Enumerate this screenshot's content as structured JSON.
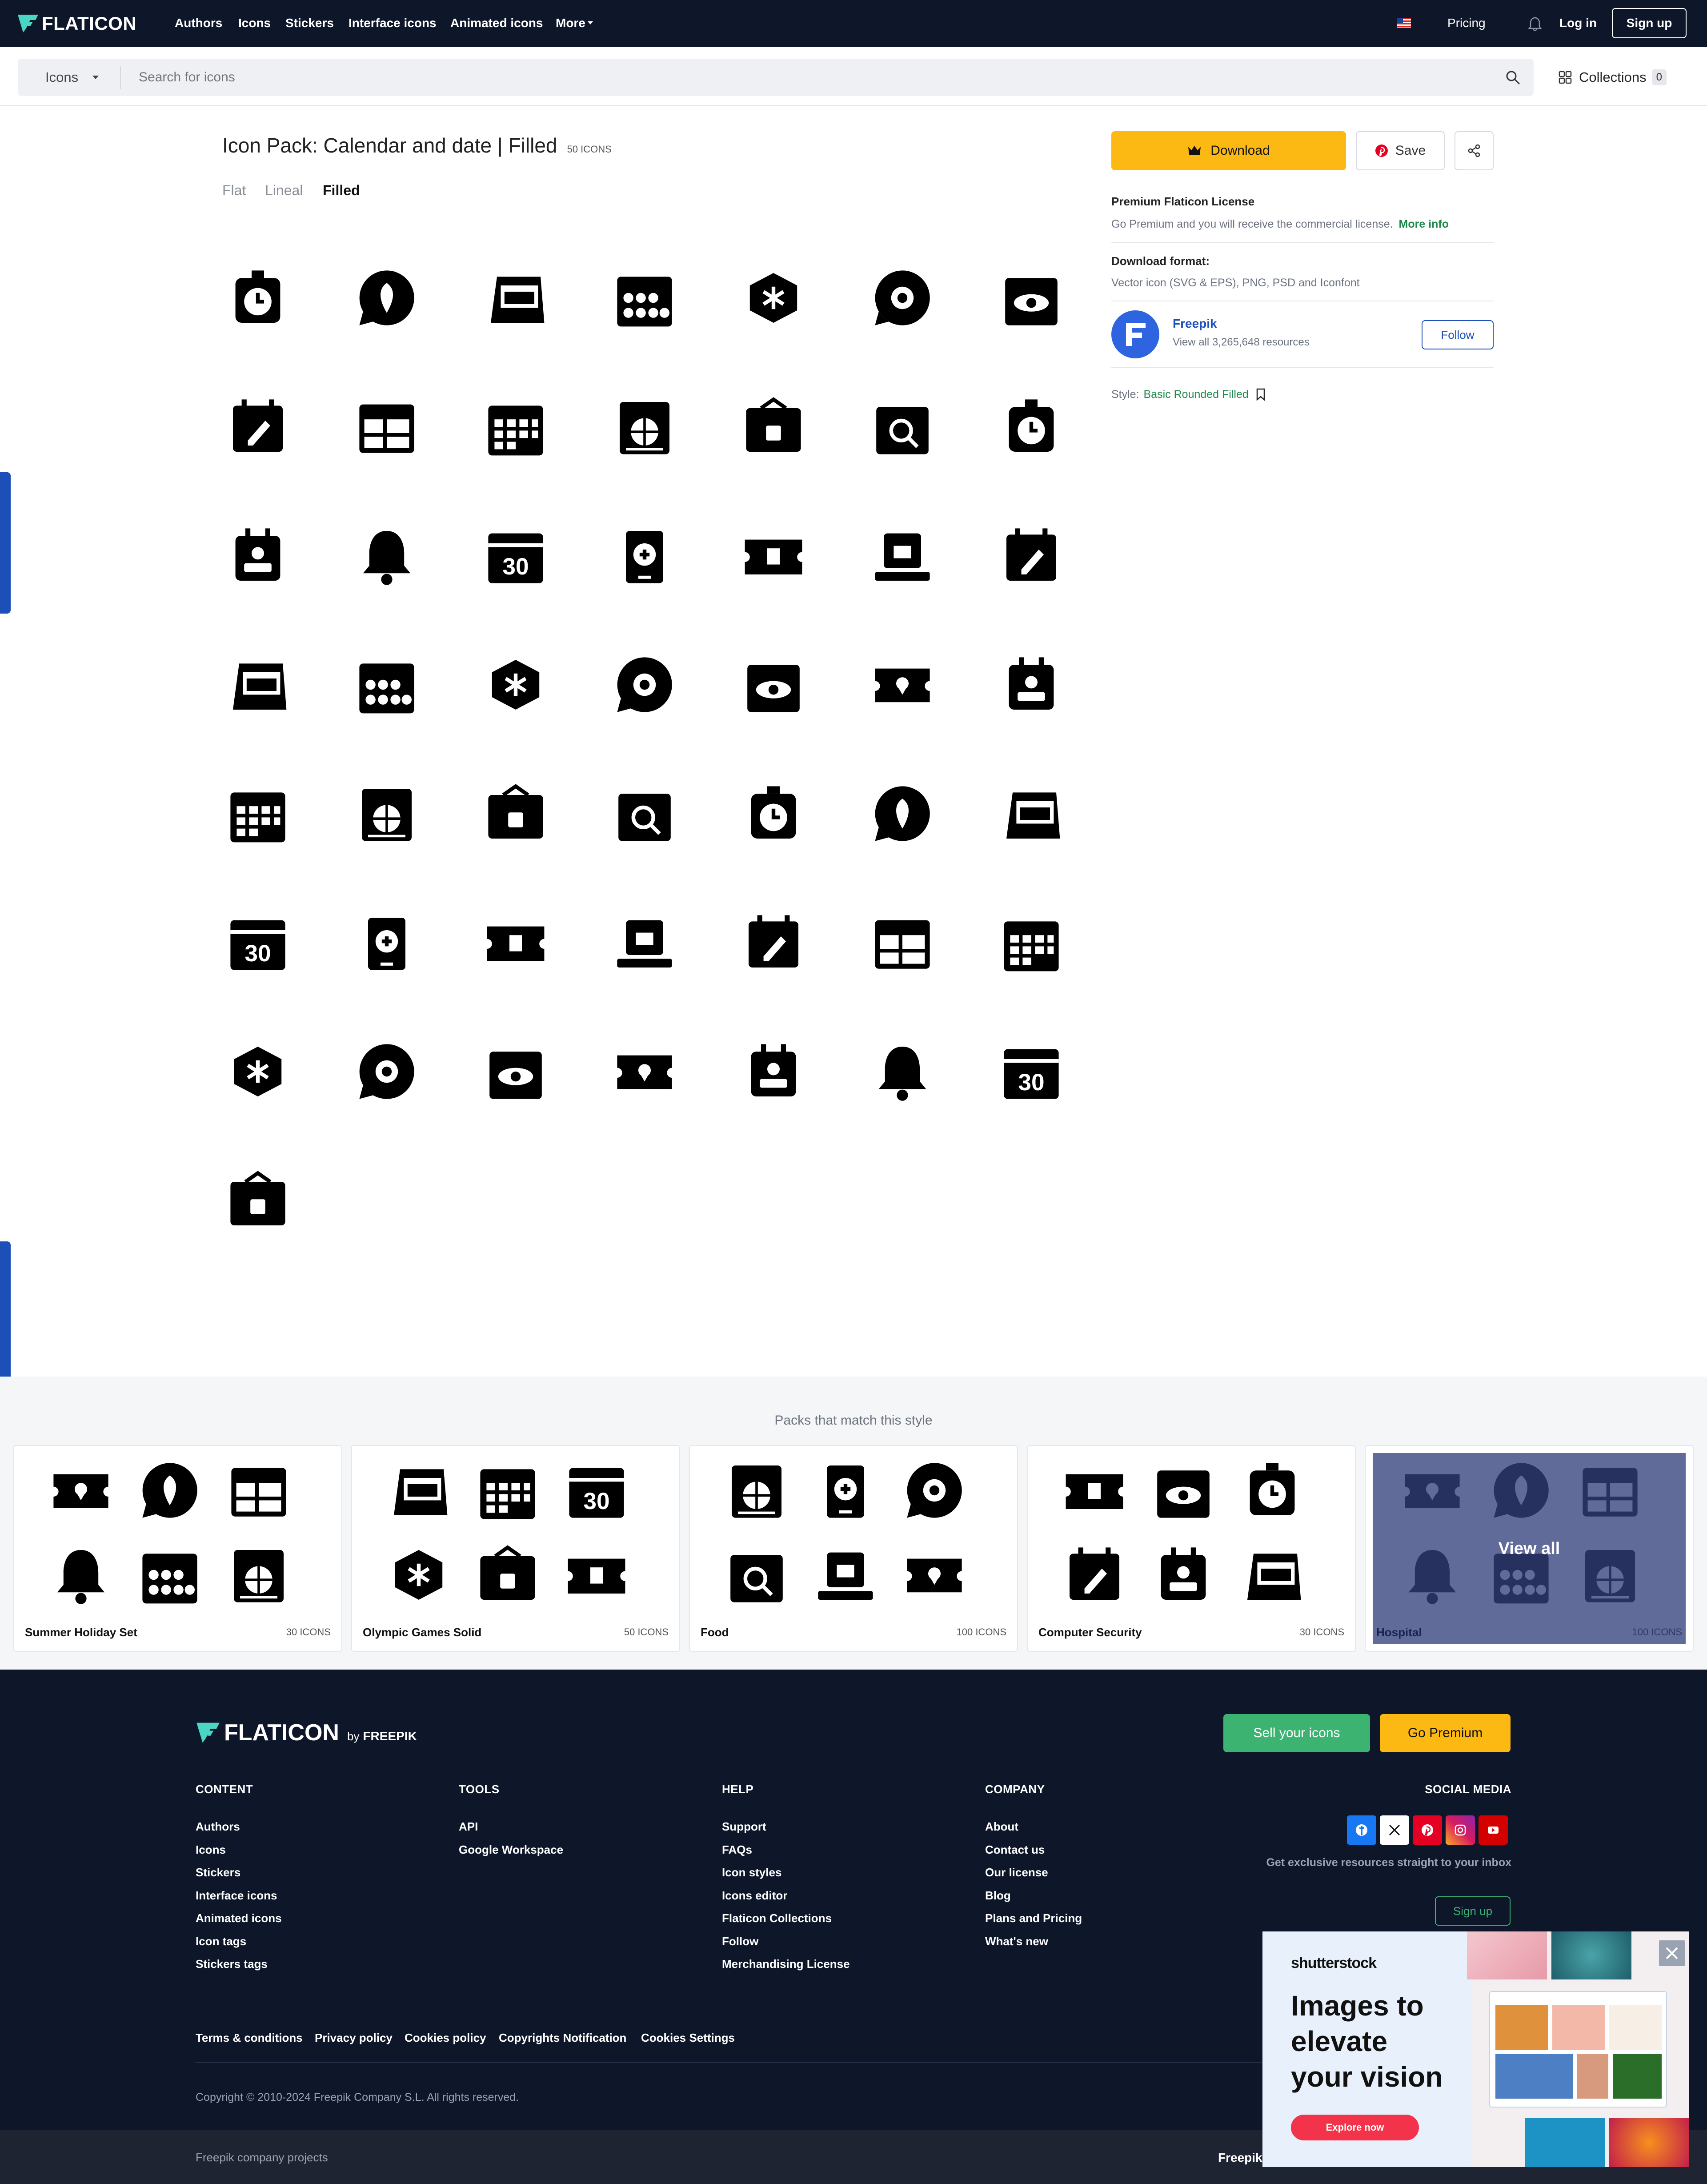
{
  "nav": {
    "logo": "FLATICON",
    "links": [
      "Authors",
      "Icons",
      "Stickers",
      "Interface icons",
      "Animated icons",
      "More"
    ],
    "pricing": "Pricing",
    "login": "Log in",
    "signup": "Sign up"
  },
  "search": {
    "category": "Icons",
    "placeholder": "Search for icons",
    "collections_label": "Collections",
    "collections_count": "0"
  },
  "pack": {
    "title": "Icon Pack: Calendar and date | Filled",
    "count": "50 ICONS",
    "tabs": [
      "Flat",
      "Lineal",
      "Filled"
    ],
    "active_tab": "Filled",
    "icons": [
      "clock-calendar-icon",
      "ticket-location-icon",
      "calendar-edit-icon",
      "leaf-chat-icon",
      "calendar-badge-icon",
      "calendar-grid-icon",
      "desk-calendar-icon",
      "bell-icon",
      "calendar-month-icon",
      "calendar-dots-icon",
      "calendar-note-icon",
      "calendar-list-icon",
      "calendar-30-icon",
      "calendar-31-icon",
      "calendar-globe-icon",
      "calendar-01-icon",
      "bell-ring-icon",
      "calendar-money-icon",
      "calendar-bag-icon",
      "calendar-box-icon",
      "calendar-15-icon",
      "calendar-photo-icon",
      "calendar-days-icon",
      "calendar-hourglass-icon",
      "cuckoo-clock-icon",
      "hexagon-snow-icon",
      "calendar-plus-icon",
      "calendar-minus-icon",
      "calendar-clock-icon",
      "calendar-alert-icon",
      "calendar-settings-icon",
      "calendar-money2-icon",
      "calendar-lock-icon",
      "calendar-unlock-icon",
      "chat-leaf-icon",
      "shield-moon-icon",
      "hexagon-moon-icon",
      "calendar-rows-icon",
      "calendar-compass-icon",
      "calendar-tablet-icon",
      "smartwatch-calendar-icon",
      "chat-gear-icon",
      "ticket-pin-icon",
      "ticket-trash-icon",
      "watch-infinity-icon",
      "calendar-search-icon",
      "chat-snow-icon",
      "calendar-eye-icon",
      "calendar-eye-off-icon",
      "laptop-calendar-icon"
    ]
  },
  "actions": {
    "download": "Download",
    "save": "Save",
    "license_title": "Premium Flaticon License",
    "license_text": "Go Premium and you will receive the commercial license.",
    "more_info": "More info",
    "format_title": "Download format:",
    "format_text": "Vector icon (SVG & EPS), PNG, PSD and Iconfont",
    "author_name": "Freepik",
    "author_resources": "View all 3,265,648 resources",
    "follow": "Follow",
    "style_label": "Style:",
    "style_name": "Basic Rounded Filled"
  },
  "packs": {
    "heading": "Packs that match this style",
    "view_all": "View all",
    "items": [
      {
        "name": "Summer Holiday Set",
        "count": "30 ICONS"
      },
      {
        "name": "Olympic Games Solid",
        "count": "50 ICONS"
      },
      {
        "name": "Food",
        "count": "100 ICONS"
      },
      {
        "name": "Computer Security",
        "count": "30 ICONS"
      },
      {
        "name": "Hospital",
        "count": "100 ICONS"
      }
    ]
  },
  "footer": {
    "logo": "FLATICON",
    "by": "by",
    "by_brand": "FREEPIK",
    "sell": "Sell your icons",
    "premium": "Go Premium",
    "content_head": "CONTENT",
    "content_links": [
      "Authors",
      "Icons",
      "Stickers",
      "Interface icons",
      "Animated icons",
      "Icon tags",
      "Stickers tags"
    ],
    "tools_head": "TOOLS",
    "tools_links": [
      "API",
      "Google Workspace"
    ],
    "help_head": "HELP",
    "help_links": [
      "Support",
      "FAQs",
      "Icon styles",
      "Icons editor",
      "Flaticon Collections",
      "Follow",
      "Merchandising License"
    ],
    "company_head": "COMPANY",
    "company_links": [
      "About",
      "Contact us",
      "Our license",
      "Blog",
      "Plans and Pricing",
      "What's new"
    ],
    "social_head": "SOCIAL MEDIA",
    "newsletter": "Get exclusive resources straight to your inbox",
    "newsletter_signup": "Sign up",
    "legal": [
      "Terms & conditions",
      "Privacy policy",
      "Cookies policy",
      "Copyrights Notification",
      "Cookies Settings"
    ],
    "copyright": "Copyright © 2010-2024 Freepik Company S.L. All rights reserved.",
    "projects": "Freepik company projects",
    "projects_brand": "Freepik"
  },
  "ad": {
    "brand": "shutterstock",
    "headline_1": "Images to",
    "headline_2": "elevate",
    "headline_3": "your vision",
    "cta": "Explore now"
  },
  "colors": {
    "nav_bg": "#0e1629",
    "accent_yellow": "#fdb913",
    "accent_green": "#1f8a4c",
    "link_blue": "#1c4fb8"
  }
}
